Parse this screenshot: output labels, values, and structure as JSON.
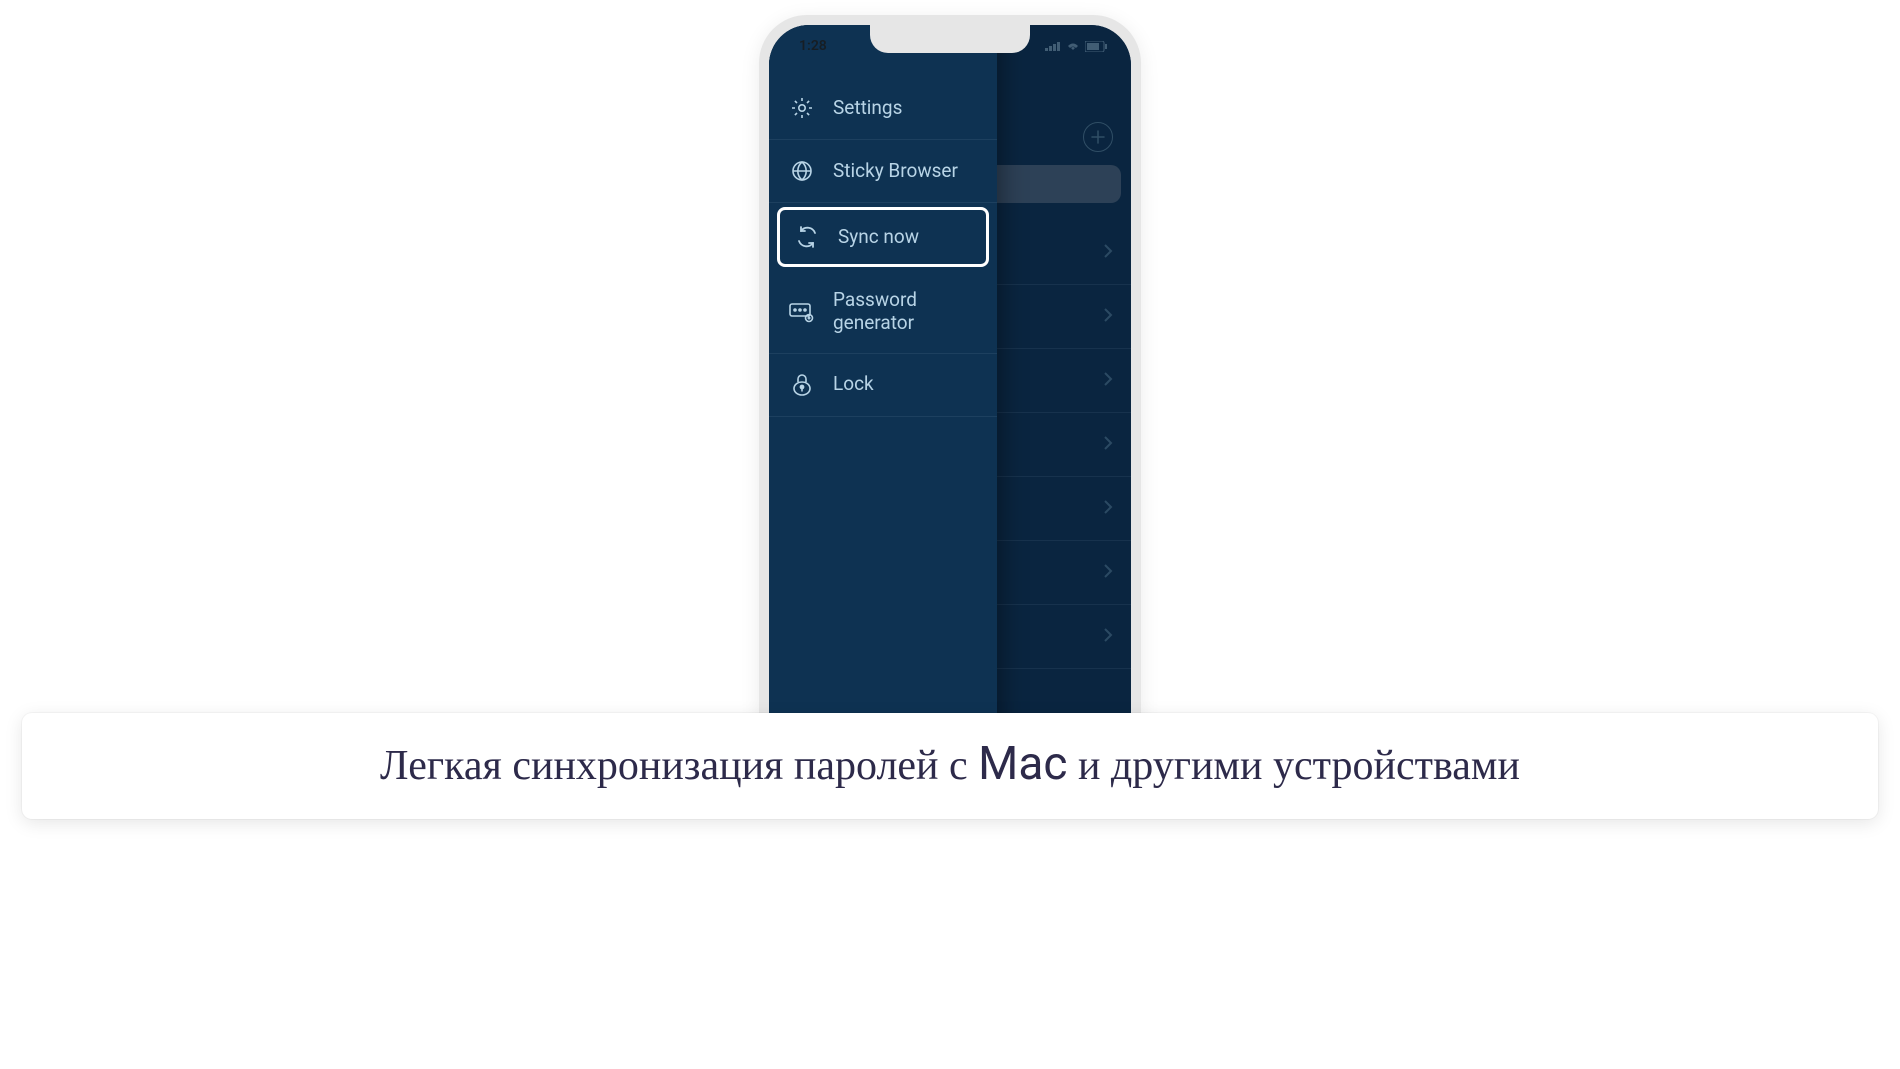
{
  "status": {
    "time": "1:28"
  },
  "drawer": {
    "items": [
      {
        "label": "Settings",
        "icon": "gear-icon"
      },
      {
        "label": "Sticky Browser",
        "icon": "globe-icon"
      },
      {
        "label": "Sync now",
        "icon": "sync-icon",
        "highlighted": true
      },
      {
        "label": "Password generator",
        "icon": "password-generator-icon"
      },
      {
        "label": "Lock",
        "icon": "lock-icon"
      }
    ]
  },
  "back_list": {
    "row_count": 7
  },
  "caption": {
    "before": "Легкая синхронизация паролей с ",
    "highlight": "Mac",
    "after": " и другими устройствами"
  }
}
